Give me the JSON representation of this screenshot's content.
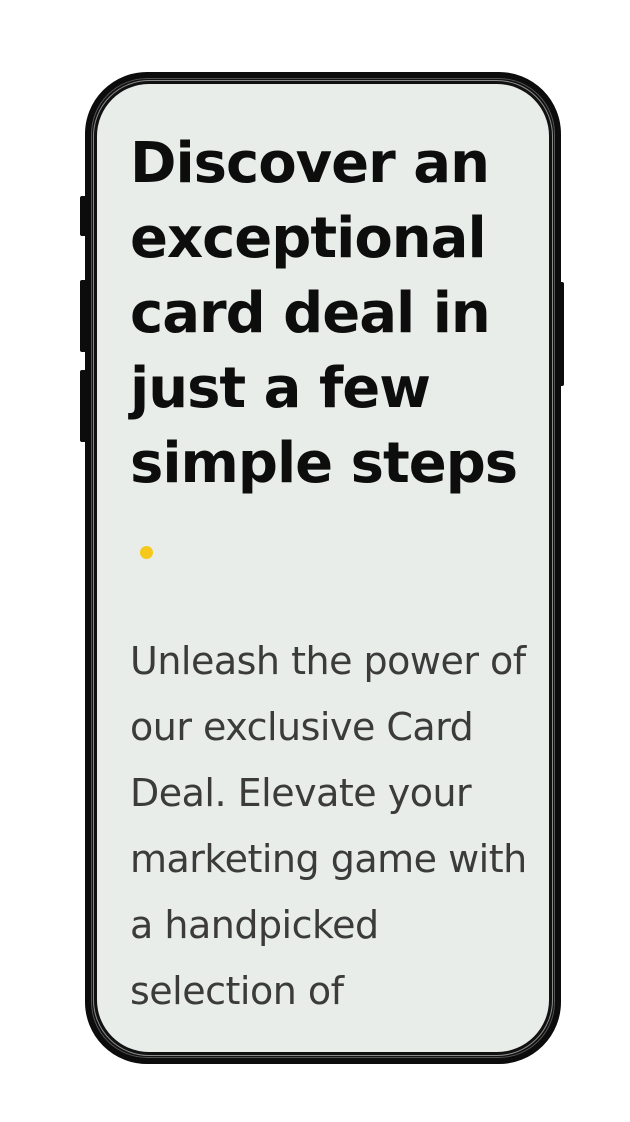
{
  "hero": {
    "headline": "Discover an exceptional card deal in just a few simple steps",
    "accent_color": "#f6c819",
    "description": "Unleash the power of our exclusive Card Deal. Elevate your marketing game with a handpicked selection of"
  }
}
